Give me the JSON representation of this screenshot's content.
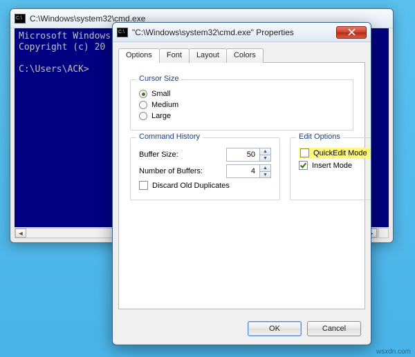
{
  "cmd": {
    "title": "C:\\Windows\\system32\\cmd.exe",
    "line1": "Microsoft Windows",
    "line2": "Copyright (c) 20",
    "prompt": "C:\\Users\\ACK>"
  },
  "props": {
    "title": "\"C:\\Windows\\system32\\cmd.exe\" Properties",
    "tabs": {
      "options": "Options",
      "font": "Font",
      "layout": "Layout",
      "colors": "Colors"
    },
    "cursor": {
      "legend": "Cursor Size",
      "small": "Small",
      "medium": "Medium",
      "large": "Large"
    },
    "history": {
      "legend": "Command History",
      "buffer_label": "Buffer Size:",
      "buffer_value": "50",
      "num_label": "Number of Buffers:",
      "num_value": "4",
      "discard": "Discard Old Duplicates"
    },
    "edit": {
      "legend": "Edit Options",
      "quick": "QuickEdit Mode",
      "insert": "Insert Mode"
    },
    "buttons": {
      "ok": "OK",
      "cancel": "Cancel"
    }
  },
  "watermark": "wsxdn.com"
}
